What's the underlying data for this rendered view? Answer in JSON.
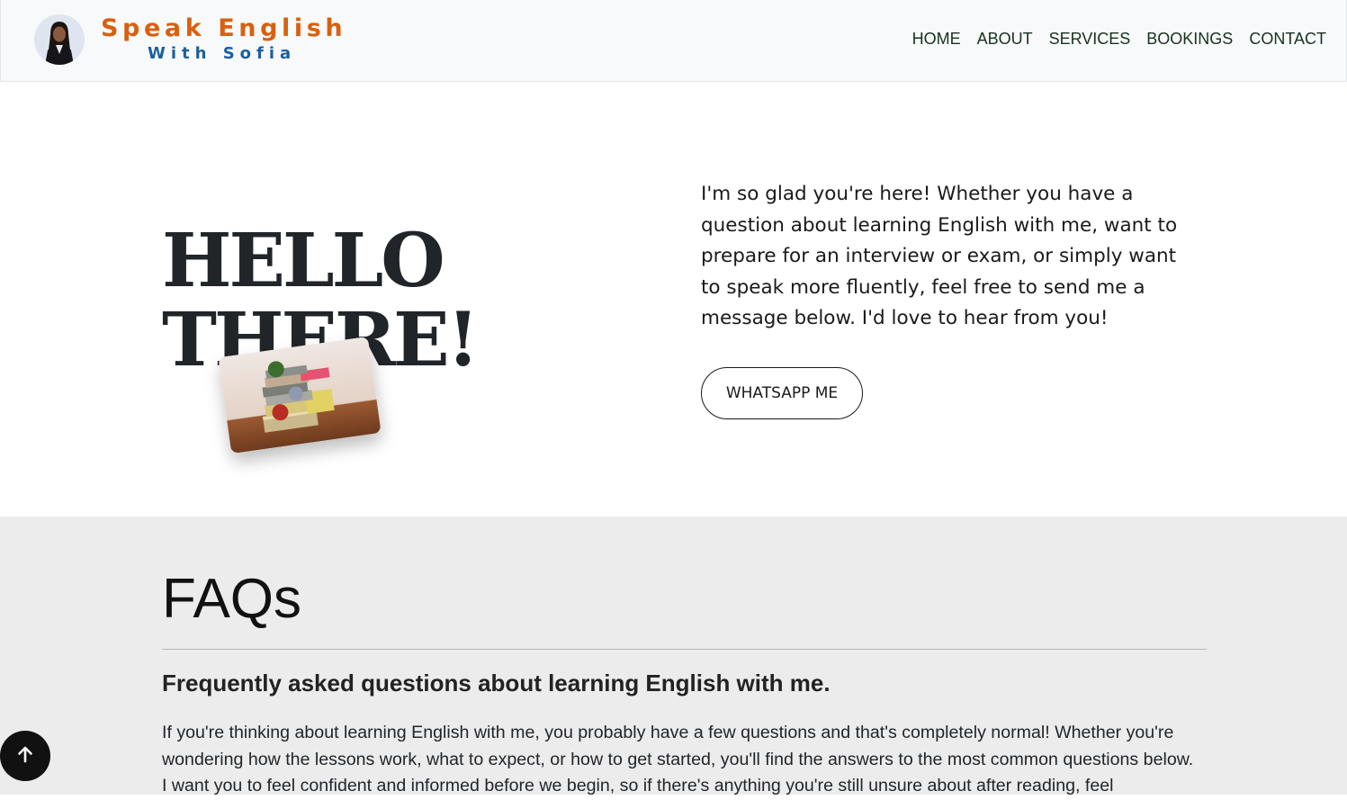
{
  "brand": {
    "title": "Speak English",
    "subtitle": "With Sofia"
  },
  "nav": {
    "items": [
      "HOME",
      "ABOUT",
      "SERVICES",
      "BOOKINGS",
      "CONTACT"
    ]
  },
  "hero": {
    "title_line1": "HELLO",
    "title_line2": "THERE!",
    "text": "I'm so glad you're here! Whether you have a question about learning English with me, want to prepare for an interview or exam, or simply want to speak more fluently, feel free to send me a message below. I'd love to hear from you!",
    "button": "WHATSAPP ME"
  },
  "faq": {
    "title": "FAQs",
    "subtitle": "Frequently asked questions about learning English with me.",
    "body": "If you're thinking about learning English with me, you probably have a few questions and that's completely normal! Whether you're wondering how the lessons work, what to expect, or how to get started, you'll find the answers to the most common questions below. I want you to feel confident and informed before we begin, so if there's anything you're still unsure about after reading, feel"
  },
  "icons": {
    "back_to_top": "arrow-up-icon"
  },
  "colors": {
    "brand_orange": "#d9600f",
    "brand_blue": "#1c5fa0",
    "nav_text": "#17311f",
    "faq_bg": "#ececec"
  }
}
